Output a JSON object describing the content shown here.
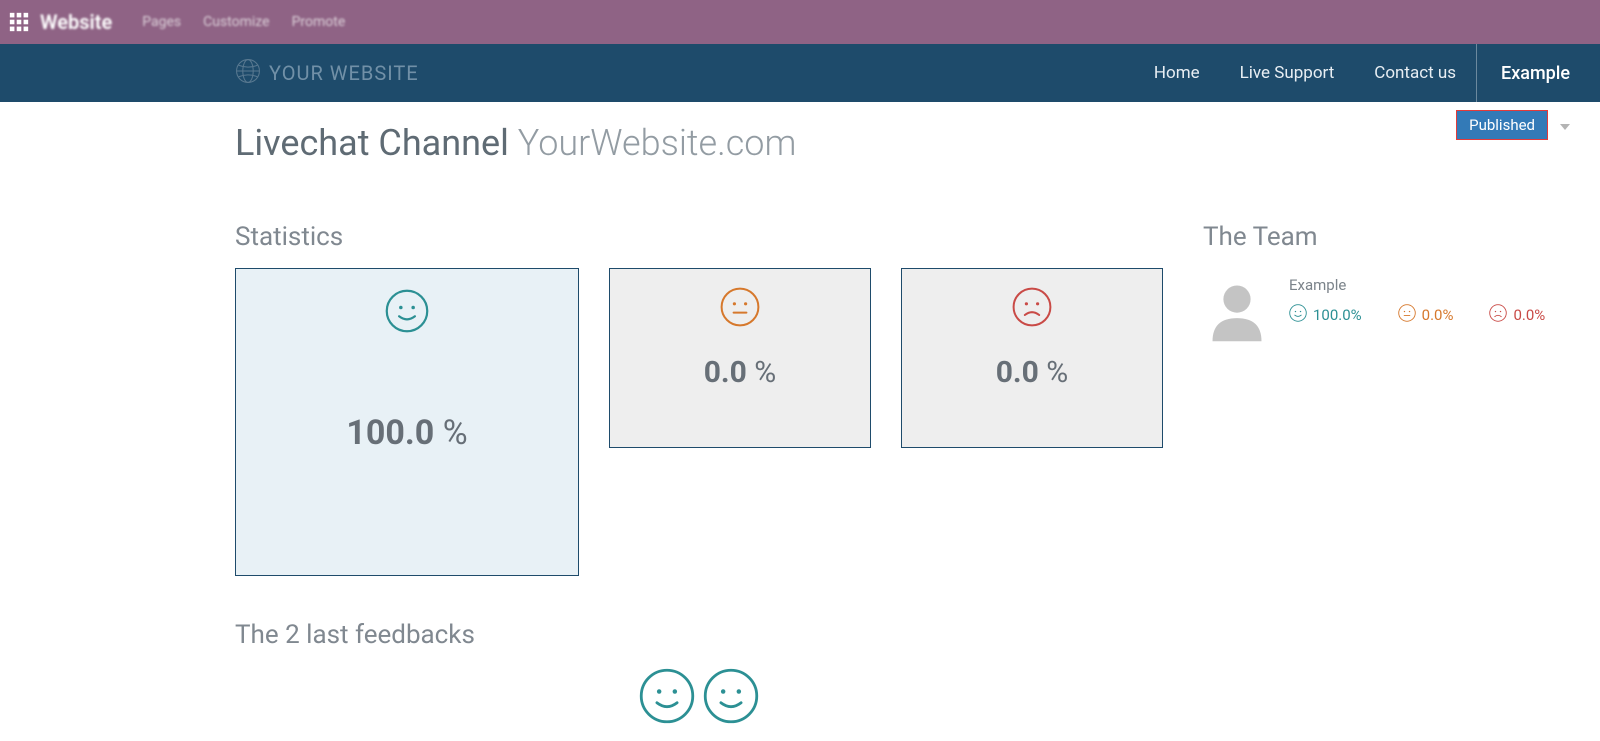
{
  "topbar": {
    "brand": "Website",
    "menu": [
      "Pages",
      "Customize",
      "Promote"
    ]
  },
  "sitebar": {
    "logo_text": "YOUR WEBSITE",
    "nav": {
      "home": "Home",
      "live_support": "Live Support",
      "contact": "Contact us"
    },
    "user": "Example"
  },
  "published_label": "Published",
  "page": {
    "title_prefix": "Livechat Channel ",
    "title_site": "YourWebsite.com"
  },
  "sections": {
    "statistics": "Statistics",
    "team": "The Team",
    "feedbacks": "The 2 last feedbacks"
  },
  "stats": {
    "happy": {
      "value": "100.0",
      "unit": " %"
    },
    "neutral": {
      "value": "0.0",
      "unit": " %"
    },
    "sad": {
      "value": "0.0",
      "unit": " %"
    }
  },
  "team": {
    "members": [
      {
        "name": "Example",
        "happy": "100.0%",
        "neutral": "0.0%",
        "sad": "0.0%"
      }
    ]
  }
}
